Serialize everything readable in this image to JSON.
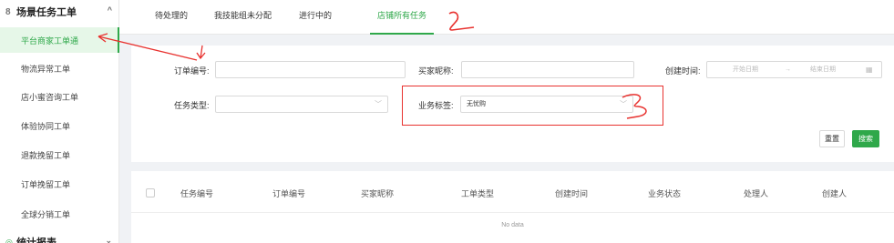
{
  "sidebar": {
    "group_title": "场景任务工单",
    "group_icon": "ticket-icon",
    "items": [
      {
        "label": "平台商家工单通",
        "active": true
      },
      {
        "label": "物流异常工单"
      },
      {
        "label": "店小蜜咨询工单"
      },
      {
        "label": "体验协同工单"
      },
      {
        "label": "退款挽留工单"
      },
      {
        "label": "订单挽留工单"
      },
      {
        "label": "全球分销工单"
      }
    ],
    "group2_title": "统计报表"
  },
  "tabs": [
    {
      "label": "待处理的"
    },
    {
      "label": "我技能组未分配"
    },
    {
      "label": "进行中的"
    },
    {
      "label": "店铺所有任务",
      "active": true
    }
  ],
  "filter": {
    "order_no_label": "订单编号:",
    "buyer_label": "买家昵称:",
    "created_label": "创建时间:",
    "start_date_placeholder": "开始日期",
    "date_sep": "→",
    "end_date_placeholder": "结束日期",
    "task_type_label": "任务类型:",
    "biz_tag_label": "业务标签:",
    "biz_tag_value": "无忧购",
    "reset_label": "重置",
    "search_label": "搜索"
  },
  "table": {
    "columns": [
      "任务编号",
      "订单编号",
      "买家昵称",
      "工单类型",
      "创建时间",
      "业务状态",
      "处理人",
      "创建人"
    ],
    "empty_text": "No data"
  },
  "annotation_color": "#e8322f",
  "accent_color": "#2fa84a"
}
